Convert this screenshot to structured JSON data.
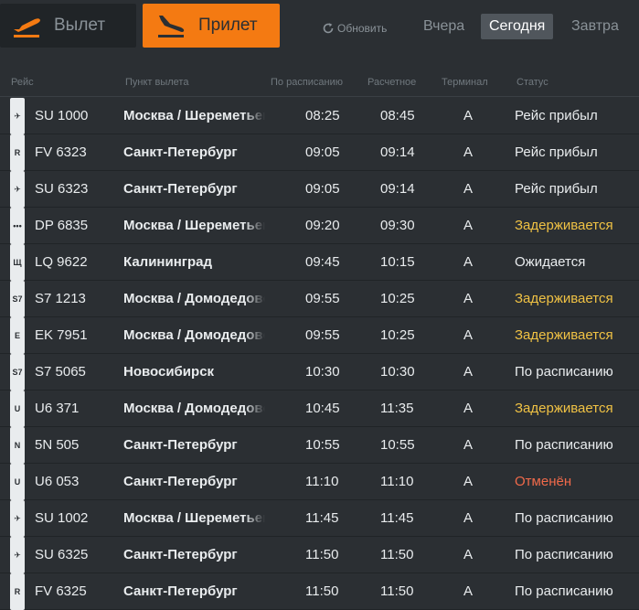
{
  "tabs": {
    "departures": "Вылет",
    "arrivals": "Прилет"
  },
  "refresh_label": "Обновить",
  "days": {
    "yesterday": "Вчера",
    "today": "Сегодня",
    "tomorrow": "Завтра"
  },
  "columns": {
    "flight": "Рейс",
    "origin": "Пункт вылета",
    "scheduled": "По расписанию",
    "estimated": "Расчетное",
    "terminal": "Терминал",
    "status": "Статус"
  },
  "colors": {
    "accent": "#f47a12",
    "delayed": "#f0c244",
    "cancelled": "#f06a4a",
    "background": "#2b2f33"
  },
  "flights": [
    {
      "logo": "aeroflot-logo",
      "flight": "SU 1000",
      "origin": "Москва / Шереметьево",
      "scheduled": "08:25",
      "estimated": "08:45",
      "terminal": "A",
      "status": "Рейс прибыл",
      "status_kind": "arrived"
    },
    {
      "logo": "rossiya-logo",
      "flight": "FV 6323",
      "origin": "Санкт-Петербург",
      "scheduled": "09:05",
      "estimated": "09:14",
      "terminal": "A",
      "status": "Рейс прибыл",
      "status_kind": "arrived"
    },
    {
      "logo": "aeroflot-logo",
      "flight": "SU 6323",
      "origin": "Санкт-Петербург",
      "scheduled": "09:05",
      "estimated": "09:14",
      "terminal": "A",
      "status": "Рейс прибыл",
      "status_kind": "arrived"
    },
    {
      "logo": "pobeda-logo",
      "flight": "DP 6835",
      "origin": "Москва / Шереметьево",
      "scheduled": "09:20",
      "estimated": "09:30",
      "terminal": "A",
      "status": "Задерживается",
      "status_kind": "delayed"
    },
    {
      "logo": "lukoil-logo",
      "flight": "LQ 9622",
      "origin": "Калининград",
      "scheduled": "09:45",
      "estimated": "10:15",
      "terminal": "A",
      "status": "Ожидается",
      "status_kind": "expected"
    },
    {
      "logo": "s7-logo",
      "flight": "S7 1213",
      "origin": "Москва / Домодедово",
      "scheduled": "09:55",
      "estimated": "10:25",
      "terminal": "A",
      "status": "Задерживается",
      "status_kind": "delayed"
    },
    {
      "logo": "emirates-logo",
      "flight": "EK 7951",
      "origin": "Москва / Домодедово",
      "scheduled": "09:55",
      "estimated": "10:25",
      "terminal": "A",
      "status": "Задерживается",
      "status_kind": "delayed"
    },
    {
      "logo": "s7-logo",
      "flight": "S7 5065",
      "origin": "Новосибирск",
      "scheduled": "10:30",
      "estimated": "10:30",
      "terminal": "A",
      "status": "По расписанию",
      "status_kind": "scheduled"
    },
    {
      "logo": "ural-logo",
      "flight": "U6 371",
      "origin": "Москва / Домодедово",
      "scheduled": "10:45",
      "estimated": "11:35",
      "terminal": "A",
      "status": "Задерживается",
      "status_kind": "delayed"
    },
    {
      "logo": "nordwind-logo",
      "flight": "5N 505",
      "origin": "Санкт-Петербург",
      "scheduled": "10:55",
      "estimated": "10:55",
      "terminal": "A",
      "status": "По расписанию",
      "status_kind": "scheduled"
    },
    {
      "logo": "ural-logo",
      "flight": "U6 053",
      "origin": "Санкт-Петербург",
      "scheduled": "11:10",
      "estimated": "11:10",
      "terminal": "A",
      "status": "Отменён",
      "status_kind": "cancelled"
    },
    {
      "logo": "aeroflot-logo",
      "flight": "SU 1002",
      "origin": "Москва / Шереметьево",
      "scheduled": "11:45",
      "estimated": "11:45",
      "terminal": "A",
      "status": "По расписанию",
      "status_kind": "scheduled"
    },
    {
      "logo": "aeroflot-logo",
      "flight": "SU 6325",
      "origin": "Санкт-Петербург",
      "scheduled": "11:50",
      "estimated": "11:50",
      "terminal": "A",
      "status": "По расписанию",
      "status_kind": "scheduled"
    },
    {
      "logo": "rossiya-logo",
      "flight": "FV 6325",
      "origin": "Санкт-Петербург",
      "scheduled": "11:50",
      "estimated": "11:50",
      "terminal": "A",
      "status": "По расписанию",
      "status_kind": "scheduled"
    }
  ]
}
